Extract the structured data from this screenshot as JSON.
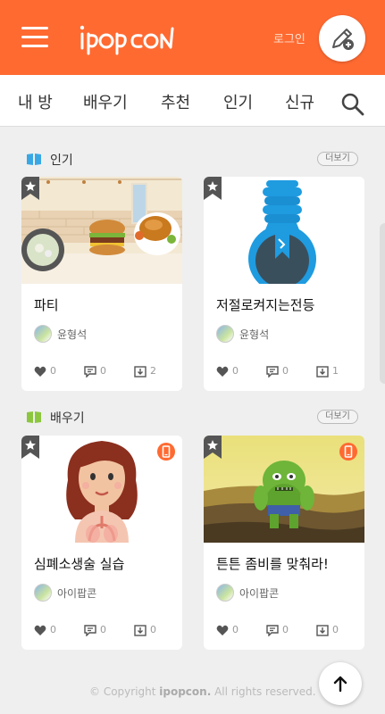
{
  "header": {
    "logo_text": "ipopcon",
    "login_label": "로그인",
    "create_button_icon": "pencil-plus-icon",
    "bg_color": "#ff6a31"
  },
  "nav": {
    "tabs": [
      {
        "label": "내 방"
      },
      {
        "label": "배우기"
      },
      {
        "label": "추천"
      },
      {
        "label": "인기"
      },
      {
        "label": "신규"
      }
    ],
    "search_icon": "search-icon"
  },
  "sections": [
    {
      "title": "인기",
      "more_label": "더보기",
      "icon_color": "#3aa7e5",
      "cards": [
        {
          "title": "파티",
          "author": "윤형석",
          "likes": "0",
          "comments": "0",
          "downloads": "2",
          "mobile_badge": false
        },
        {
          "title": "저절로켜지는전등",
          "author": "윤형석",
          "likes": "0",
          "comments": "0",
          "downloads": "1",
          "mobile_badge": false
        }
      ]
    },
    {
      "title": "배우기",
      "more_label": "더보기",
      "icon_color": "#8cc63f",
      "cards": [
        {
          "title": "심폐소생술 실습",
          "author": "아이팝콘",
          "likes": "0",
          "comments": "0",
          "downloads": "0",
          "mobile_badge": true
        },
        {
          "title": "튼튼 좀비를 맞춰라!",
          "author": "아이팝콘",
          "likes": "0",
          "comments": "0",
          "downloads": "0",
          "mobile_badge": true
        }
      ]
    }
  ],
  "footer": {
    "prefix": "© Copyright ",
    "brand": "ipopcon.",
    "suffix": " All rights reserved."
  }
}
